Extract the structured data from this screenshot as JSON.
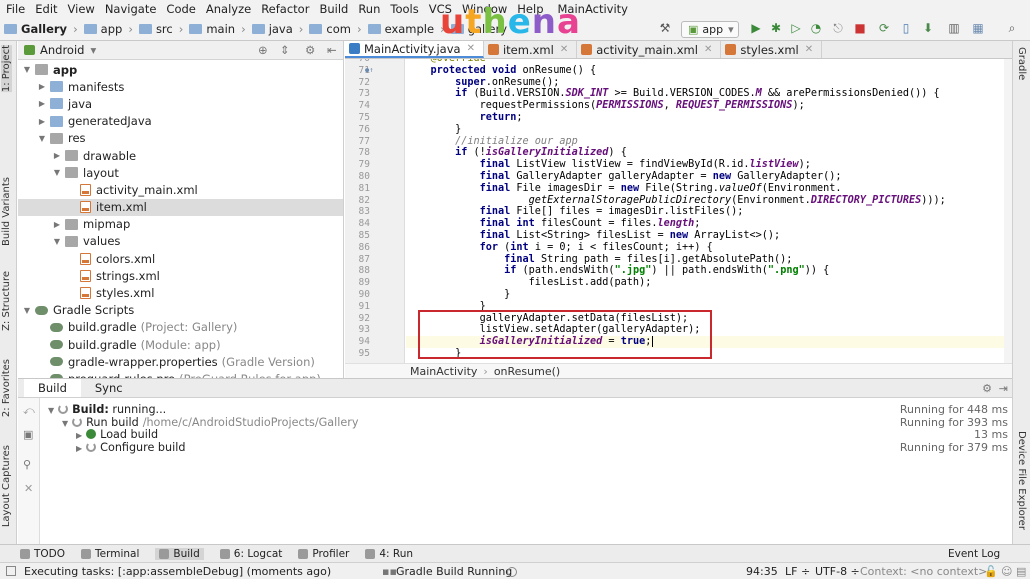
{
  "menu": [
    "File",
    "Edit",
    "View",
    "Navigate",
    "Code",
    "Analyze",
    "Refactor",
    "Build",
    "Run",
    "Tools",
    "VCS",
    "Window",
    "Help"
  ],
  "window_title_fragment": "MainActivity",
  "breadcrumbs": [
    "Gallery",
    "app",
    "src",
    "main",
    "java",
    "com",
    "example",
    "gallery"
  ],
  "logo": {
    "text": "uthena",
    "colors": [
      "#e8443a",
      "#f5a623",
      "#7ac143",
      "#29b6e8",
      "#8e5cc8",
      "#e84393"
    ]
  },
  "run_config": "app",
  "project_panel": {
    "view": "Android",
    "tree": [
      {
        "label": "app",
        "level": 0,
        "type": "foldg",
        "expanded": true,
        "bold": true
      },
      {
        "label": "manifests",
        "level": 1,
        "type": "folder",
        "expanded": false
      },
      {
        "label": "java",
        "level": 1,
        "type": "folder",
        "expanded": false
      },
      {
        "label": "generatedJava",
        "level": 1,
        "type": "folder",
        "expanded": false
      },
      {
        "label": "res",
        "level": 1,
        "type": "foldg",
        "expanded": true
      },
      {
        "label": "drawable",
        "level": 2,
        "type": "foldg",
        "expanded": false
      },
      {
        "label": "layout",
        "level": 2,
        "type": "foldg",
        "expanded": true
      },
      {
        "label": "activity_main.xml",
        "level": 3,
        "type": "xml"
      },
      {
        "label": "item.xml",
        "level": 3,
        "type": "xml",
        "selected": true
      },
      {
        "label": "mipmap",
        "level": 2,
        "type": "foldg",
        "expanded": false
      },
      {
        "label": "values",
        "level": 2,
        "type": "foldg",
        "expanded": true
      },
      {
        "label": "colors.xml",
        "level": 3,
        "type": "xml"
      },
      {
        "label": "strings.xml",
        "level": 3,
        "type": "xml"
      },
      {
        "label": "styles.xml",
        "level": 3,
        "type": "xml"
      },
      {
        "label": "Gradle Scripts",
        "level": 0,
        "type": "gradle",
        "expanded": true
      },
      {
        "label": "build.gradle",
        "hint": "(Project: Gallery)",
        "level": 1,
        "type": "gradle"
      },
      {
        "label": "build.gradle",
        "hint": "(Module: app)",
        "level": 1,
        "type": "gradle"
      },
      {
        "label": "gradle-wrapper.properties",
        "hint": "(Gradle Version)",
        "level": 1,
        "type": "gradle"
      },
      {
        "label": "proguard-rules.pro",
        "hint": "(ProGuard Rules for app)",
        "level": 1,
        "type": "gradle"
      }
    ]
  },
  "left_tool_windows": [
    "1: Project",
    "Build Variants",
    "Z: Structure",
    "2: Favorites",
    "Layout Captures"
  ],
  "right_tool_windows": [
    "Gradle",
    "Device File Explorer"
  ],
  "editor_tabs": [
    {
      "label": "MainActivity.java",
      "active": true,
      "color": "#3b7dc4"
    },
    {
      "label": "item.xml",
      "active": false,
      "color": "#d6773a"
    },
    {
      "label": "activity_main.xml",
      "active": false,
      "color": "#d6773a"
    },
    {
      "label": "styles.xml",
      "active": false,
      "color": "#d6773a"
    }
  ],
  "code": {
    "first_line_number": 70,
    "lines": [
      [
        [
          "an",
          "    @Override"
        ]
      ],
      [
        [
          "kw",
          "    protected void "
        ],
        [
          "",
          "onResume() {"
        ]
      ],
      [
        [
          "kw",
          "        super"
        ],
        [
          "",
          ".onResume();"
        ]
      ],
      [
        [
          "kw",
          "        if "
        ],
        [
          "",
          "(Build.VERSION."
        ],
        [
          "fi",
          "SDK_INT"
        ],
        [
          "",
          " >= Build.VERSION_CODES."
        ],
        [
          "fi",
          "M"
        ],
        [
          "",
          " && arePermissionsDenied()) {"
        ]
      ],
      [
        [
          "",
          "            requestPermissions("
        ],
        [
          "fi",
          "PERMISSIONS"
        ],
        [
          "",
          ", "
        ],
        [
          "fi",
          "REQUEST_PERMISSIONS"
        ],
        [
          "",
          ");"
        ]
      ],
      [
        [
          "kw",
          "            return"
        ],
        [
          "",
          ";"
        ]
      ],
      [
        [
          "",
          "        }"
        ]
      ],
      [
        [
          "cm",
          "        //initialize our app"
        ]
      ],
      [
        [
          "kw",
          "        if "
        ],
        [
          "",
          "(!"
        ],
        [
          "fi",
          "isGalleryInitialized"
        ],
        [
          "",
          ") {"
        ]
      ],
      [
        [
          "kw",
          "            final "
        ],
        [
          "",
          "ListView listView = findViewById(R.id."
        ],
        [
          "fi",
          "listView"
        ],
        [
          "",
          ");"
        ]
      ],
      [
        [
          "kw",
          "            final "
        ],
        [
          "",
          "GalleryAdapter galleryAdapter = "
        ],
        [
          "kw",
          "new "
        ],
        [
          "",
          "GalleryAdapter();"
        ]
      ],
      [
        [
          "kw",
          "            final "
        ],
        [
          "",
          "File imagesDir = "
        ],
        [
          "kw",
          "new "
        ],
        [
          "",
          "File(String."
        ],
        [
          "it",
          "valueOf"
        ],
        [
          "",
          "(Environment."
        ]
      ],
      [
        [
          "",
          "                    "
        ],
        [
          "it",
          "getExternalStoragePublicDirectory"
        ],
        [
          "",
          "(Environment."
        ],
        [
          "fi",
          "DIRECTORY_PICTURES"
        ],
        [
          "",
          ")));"
        ]
      ],
      [
        [
          "kw",
          "            final "
        ],
        [
          "",
          "File[] files = imagesDir.listFiles();"
        ]
      ],
      [
        [
          "kw",
          "            final int "
        ],
        [
          "",
          "filesCount = files."
        ],
        [
          "fi",
          "length"
        ],
        [
          "",
          ";"
        ]
      ],
      [
        [
          "kw",
          "            final "
        ],
        [
          "",
          "List<String> filesList = "
        ],
        [
          "kw",
          "new "
        ],
        [
          "",
          "ArrayList<>();"
        ]
      ],
      [
        [
          "kw",
          "            for "
        ],
        [
          "",
          "("
        ],
        [
          "kw",
          "int "
        ],
        [
          "",
          "i = "
        ],
        [
          "",
          "0"
        ],
        [
          "",
          "; i < filesCount; i++) {"
        ]
      ],
      [
        [
          "kw",
          "                final "
        ],
        [
          "",
          "String path = files[i].getAbsolutePath();"
        ]
      ],
      [
        [
          "kw",
          "                if "
        ],
        [
          "",
          "(path.endsWith("
        ],
        [
          "st",
          "\".jpg\""
        ],
        [
          "",
          ") || path.endsWith("
        ],
        [
          "st",
          "\".png\""
        ],
        [
          "",
          ")) {"
        ]
      ],
      [
        [
          "",
          "                    filesList.add(path);"
        ]
      ],
      [
        [
          "",
          "                }"
        ]
      ],
      [
        [
          "",
          "            }"
        ]
      ],
      [
        [
          "",
          "            galleryAdapter.setData(filesList);"
        ]
      ],
      [
        [
          "",
          "            listView.setAdapter(galleryAdapter);"
        ]
      ],
      [
        [
          "fi",
          "            isGalleryInitialized"
        ],
        [
          "",
          " = "
        ],
        [
          "kw",
          "true"
        ],
        [
          "",
          ";"
        ]
      ],
      [
        [
          "",
          "        }"
        ]
      ]
    ],
    "current_line_index": 24
  },
  "editor_breadcrumb": [
    "MainActivity",
    "onResume()"
  ],
  "build_panel": {
    "tabs": [
      "Build",
      "Sync"
    ],
    "rows": [
      {
        "label": "Build:",
        "text": " running...",
        "status": "Running for 448 ms",
        "indent": 0,
        "icon": "spin"
      },
      {
        "label": "",
        "text": "Run build",
        "hint": "/home/c/AndroidStudioProjects/Gallery",
        "status": "Running for 393 ms",
        "indent": 1,
        "icon": "spin"
      },
      {
        "label": "",
        "text": "Load build",
        "status": "13 ms",
        "indent": 2,
        "icon": "ok"
      },
      {
        "label": "",
        "text": "Configure build",
        "status": "Running for 379 ms",
        "indent": 2,
        "icon": "spin"
      }
    ]
  },
  "tool_windows_bottom": [
    "TODO",
    "Terminal",
    "Build",
    "6: Logcat",
    "Profiler",
    "4: Run"
  ],
  "active_bottom_tool": "Build",
  "event_log": "Event Log",
  "status_bar": {
    "message": "Executing tasks: [:app:assembleDebug] (moments ago)",
    "progress_text": "Gradle Build Running",
    "position": "94:35",
    "line_sep": "LF ÷",
    "encoding": "UTF-8 ÷",
    "context": "Context: <no context>"
  }
}
